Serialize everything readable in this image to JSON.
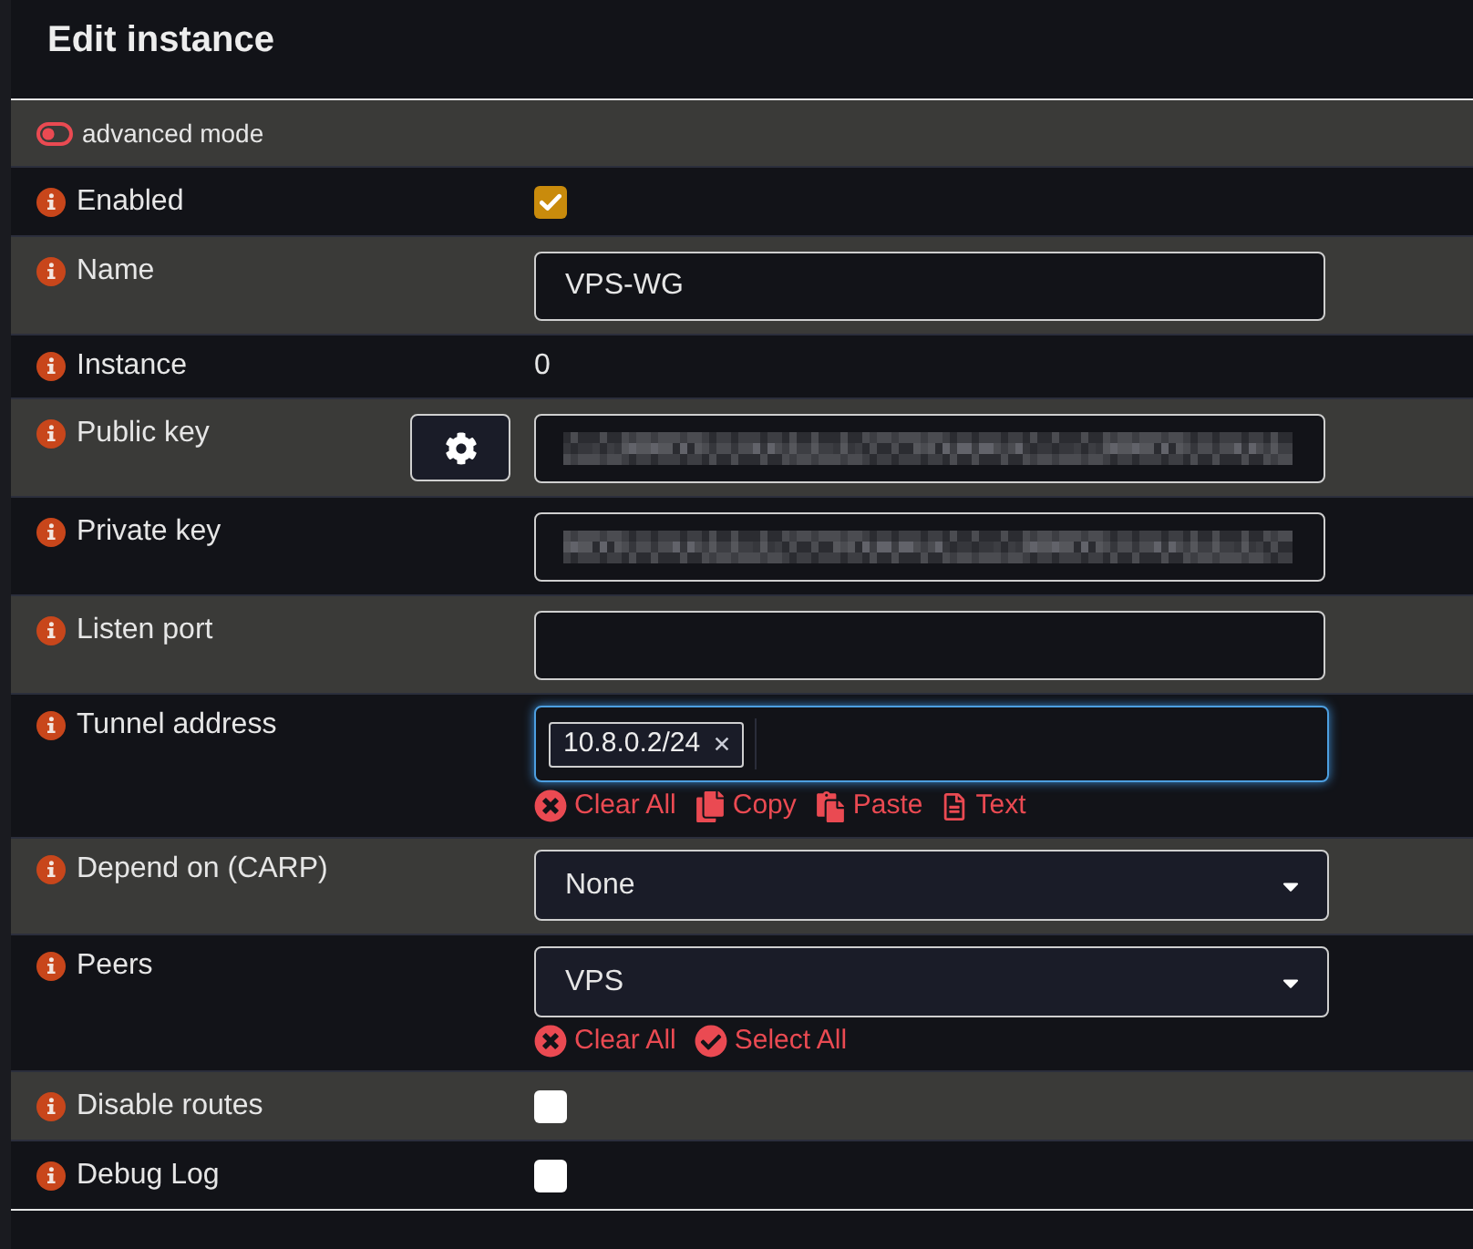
{
  "dialog": {
    "title": "Edit instance"
  },
  "advanced_mode": {
    "label": "advanced mode",
    "on": false
  },
  "fields": [
    {
      "kind": "checkbox",
      "label": "Enabled",
      "checked": true
    },
    {
      "kind": "text",
      "label": "Name",
      "value": "VPS-WG"
    },
    {
      "kind": "static",
      "label": "Instance",
      "value": "0"
    },
    {
      "kind": "blurred",
      "label": "Public key",
      "icon_button": true
    },
    {
      "kind": "blurred",
      "label": "Private key"
    },
    {
      "kind": "text",
      "label": "Listen port"
    },
    {
      "kind": "tags",
      "label": "Tunnel address",
      "tags": [
        "10.8.0.2/24"
      ],
      "focused": true,
      "actions": [
        {
          "kind": "clear",
          "label": "Clear All"
        },
        {
          "kind": "copy",
          "label": "Copy"
        },
        {
          "kind": "paste",
          "label": "Paste"
        },
        {
          "kind": "text",
          "label": "Text"
        }
      ]
    },
    {
      "kind": "select",
      "label": "Depend on (CARP)",
      "value": "None"
    },
    {
      "kind": "select",
      "label": "Peers",
      "value": "VPS",
      "actions": [
        {
          "kind": "clear",
          "label": "Clear All"
        },
        {
          "kind": "check",
          "label": "Select All"
        }
      ]
    },
    {
      "kind": "checkbox",
      "label": "Disable routes",
      "checked": false
    },
    {
      "kind": "checkbox",
      "label": "Debug Log",
      "checked": false
    }
  ]
}
